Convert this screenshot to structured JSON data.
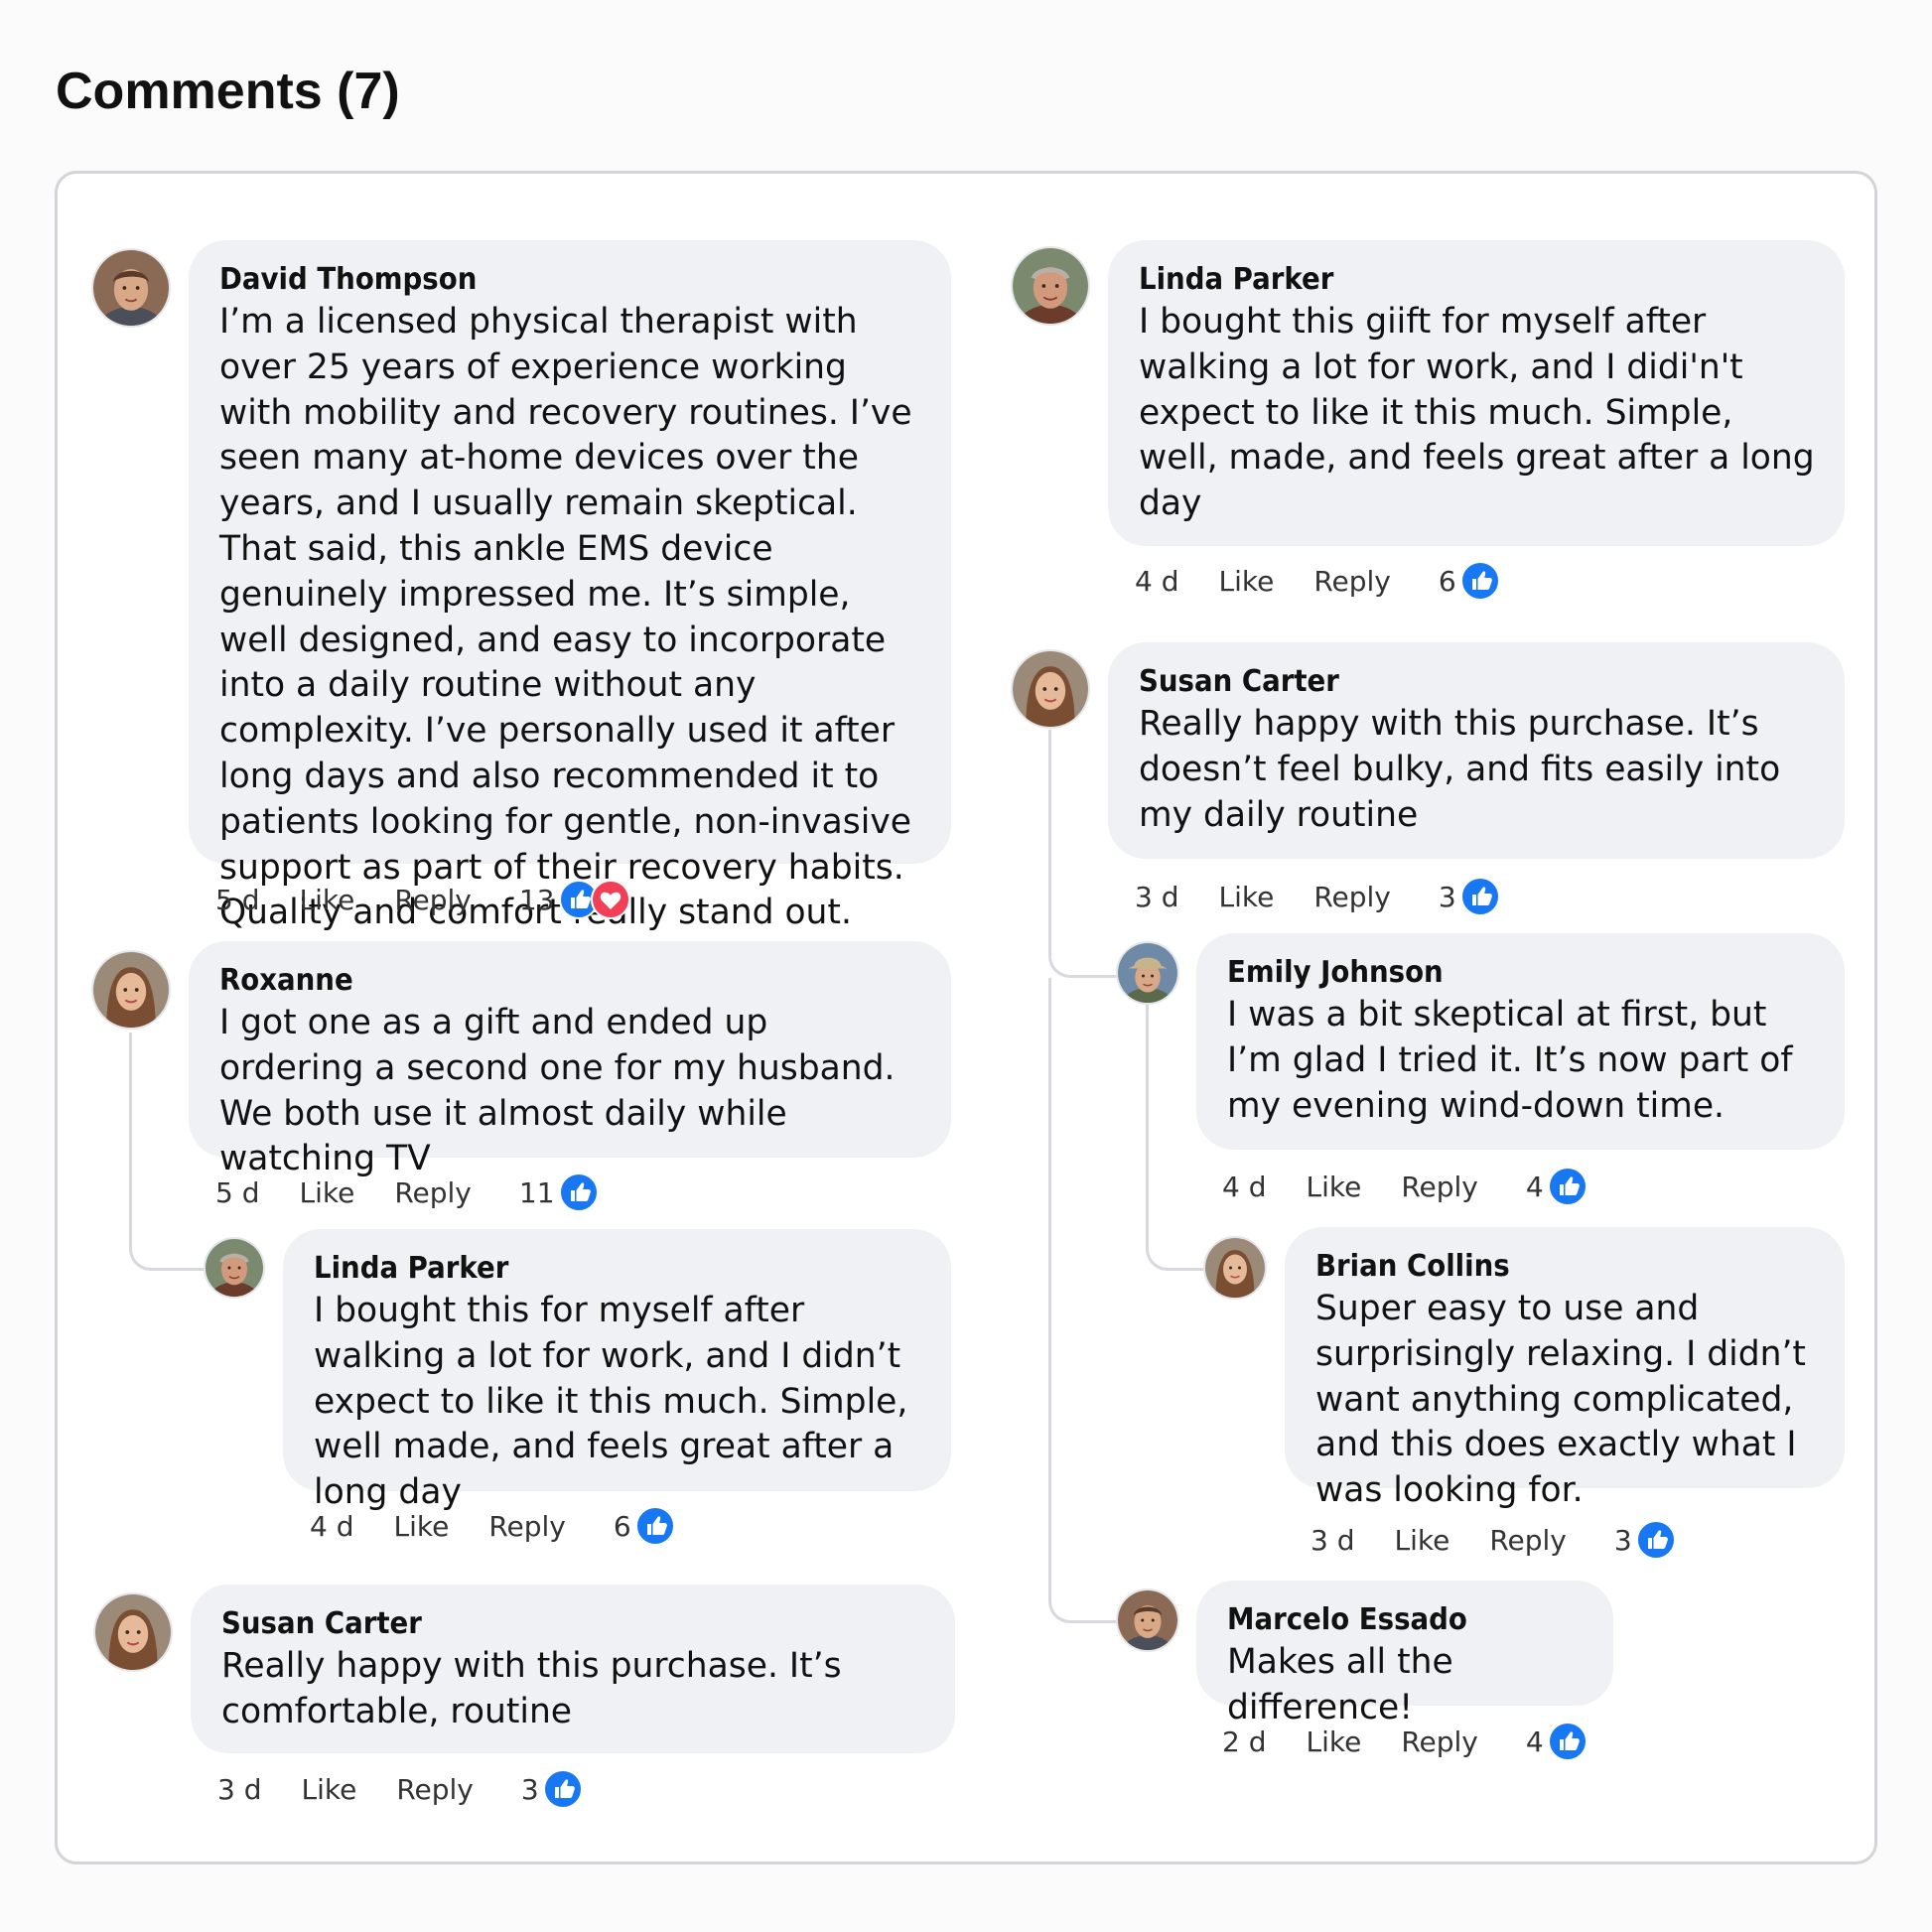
{
  "header": {
    "title": "Comments (7)"
  },
  "colors": {
    "like_blue": "#1877f2",
    "love_red": "#f33e58",
    "bubble_bg": "#eff1f4"
  },
  "icons": {
    "like": "thumbs-up-icon",
    "love": "heart-icon"
  },
  "comments": {
    "c1": {
      "author": "David Thompson",
      "text": "I’m a licensed physical therapist with over 25 years of experience working with mobility and recovery routines. I’ve seen many at-home devices over the years, and I usually remain skeptical. That said, this ankle EMS device genuinely impressed me. It’s simple, well designed, and easy to incorporate into a daily routine without any complexity. I’ve personally used it after long days and also recommended it to patients looking for gentle, non-invasive support as part of their recovery habits. Quality and comfort really stand out.",
      "time": "5 d",
      "like": "Like",
      "reply": "Reply",
      "count": "13"
    },
    "c2": {
      "author": "Roxanne",
      "text": "I got one as a gift and ended up ordering a second one for my husband. We both use it almost daily while watching TV",
      "time": "5 d",
      "like": "Like",
      "reply": "Reply",
      "count": "11"
    },
    "c3": {
      "author": "Linda Parker",
      "text": "I bought this for myself after walking a lot for work, and I didn’t expect to like it this much. Simple, well made, and feels great after a long day",
      "time": "4 d",
      "like": "Like",
      "reply": "Reply",
      "count": "6"
    },
    "c4": {
      "author": "Susan Carter",
      "text": "Really happy with this purchase. It’s comfortable, routine",
      "time": "3 d",
      "like": "Like",
      "reply": "Reply",
      "count": "3"
    },
    "c5": {
      "author": "Linda Parker",
      "text": "I bought this giift for myself after walking a lot for work, and I didi'n't expect to like it this much. Simple, well, made, and feels great after a long day",
      "time": "4 d",
      "like": "Like",
      "reply": "Reply",
      "count": "6"
    },
    "c6": {
      "author": "Susan Carter",
      "text": "Really happy with this purchase. It’s doesn’t feel bulky, and fits easily into my daily routine",
      "time": "3 d",
      "like": "Like",
      "reply": "Reply",
      "count": "3"
    },
    "c7": {
      "author": "Emily Johnson",
      "text": "I was a bit skeptical at first, but I’m glad I tried it. It’s now part of my evening wind-down time.",
      "time": "4 d",
      "like": "Like",
      "reply": "Reply",
      "count": "4"
    },
    "c8": {
      "author": "Brian Collins",
      "text": "Super easy to use and surprisingly relaxing. I didn’t want anything complicated, and this does exactly what I was looking for.",
      "time": "3 d",
      "like": "Like",
      "reply": "Reply",
      "count": "3"
    },
    "c9": {
      "author": "Marcelo Essado",
      "text": "Makes all the difference!",
      "time": "2 d",
      "like": "Like",
      "reply": "Reply",
      "count": "4"
    }
  }
}
